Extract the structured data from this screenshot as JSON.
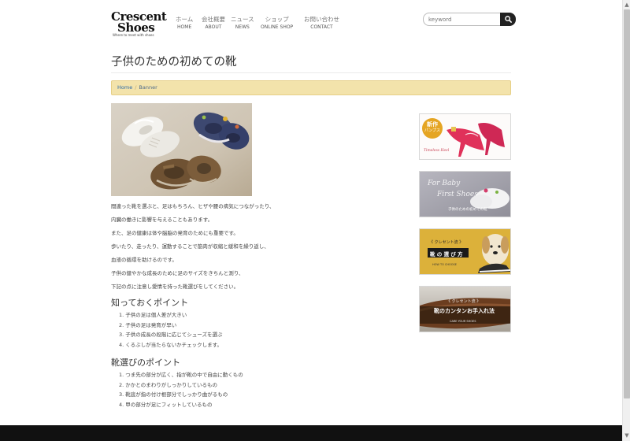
{
  "logo": {
    "line1": "Crescent",
    "line2": "Shoes",
    "tagline": "Where to meet with shoes"
  },
  "nav": [
    {
      "jp": "ホーム",
      "en": "HOME"
    },
    {
      "jp": "会社概要",
      "en": "ABOUT"
    },
    {
      "jp": "ニュース",
      "en": "NEWS"
    },
    {
      "jp": "ショップ",
      "en": "ONLINE SHOP"
    },
    {
      "jp": "お問い合わせ",
      "en": "CONTACT"
    }
  ],
  "search": {
    "placeholder": "keyword"
  },
  "page_title": "子供のための初めての靴",
  "breadcrumb": {
    "home": "Home",
    "current": "Banner"
  },
  "paragraphs": [
    "間違った靴を選ぶと、足はもちろん、ヒザや腰の病気につながったり、",
    "内臓の働きに影響を与えることもあります。",
    "また、足の健康は体や脳脳の発育のためにも重要です。",
    "歩いたり、走ったり、運動することで筋肉が収縮と緩和を繰り返し、",
    "血液の循環を助けるのです。",
    "子供の健やかな成長のために足のサイズをきちんと測り、",
    "下記の点に注意し愛情を持った靴選びをしてください。"
  ],
  "section1": {
    "heading": "知っておくポイント",
    "items": [
      "1. 子供の足は個人差が大きい",
      "2. 子供の足は発育が早い",
      "3. 子供の成長の段階に応じてシューズを選ぶ",
      "4. くるぶしが当たらないかチェックします。"
    ]
  },
  "section2": {
    "heading": "靴選びのポイント",
    "items": [
      "1. つま先の部分が広く、指が靴の中で自由に動くもの",
      "2. かかとのまわりがしっかりしているもの",
      "3. 靴底が指の付け根部分でしっかり曲がるもの",
      "4. 甲の部分が足にフィットしているもの"
    ]
  },
  "banners": {
    "b1": {
      "badge_line1": "新作",
      "badge_line2": "パンプス",
      "caption": "Timeless Heel"
    },
    "b2": {
      "script_line1": "For Baby",
      "script_line2": "First Shoes",
      "caption": "子供のための初めての靴"
    },
    "b3": {
      "small": "《 クレセント流 》",
      "title": "靴 の 選 び 方",
      "foot": "HOW TO CHOOSE"
    },
    "b4": {
      "small": "《 クレセント流 》",
      "title": "靴のカンタンお手入れ法",
      "foot": "CARE YOUR SHOES"
    }
  },
  "colors": {
    "breadcrumb_bg": "#f3e3ab",
    "link_blue": "#2a6aa8",
    "footer_bg": "#111111",
    "banner3_bg": "#dcb13a",
    "search_button_bg": "#222222"
  },
  "icons": {
    "search": "search-icon",
    "scroll_up": "chevron-up-icon",
    "scroll_down": "chevron-down-icon"
  }
}
